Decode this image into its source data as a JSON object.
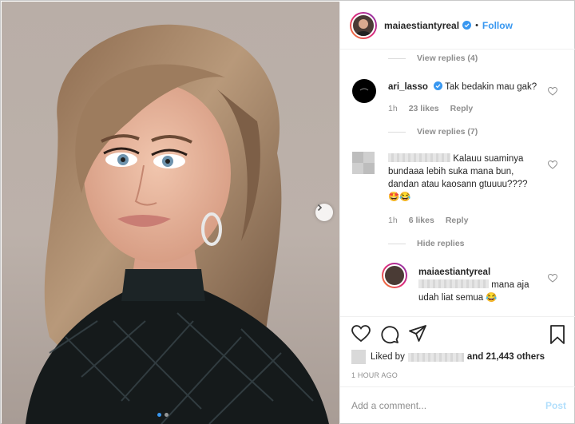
{
  "post": {
    "username": "maiaestiantyreal",
    "follow_label": "Follow",
    "separator": "•"
  },
  "comments": {
    "view_replies_1": "View replies (4)",
    "c1": {
      "user": "ari_lasso",
      "text": "Tak bedakin mau gak?",
      "time": "1h",
      "likes": "23 likes",
      "reply": "Reply"
    },
    "view_replies_2": "View replies (7)",
    "c2": {
      "text_line1": "Kalauu suaminya",
      "text_line2": "bundaaa lebih suka mana bun,",
      "text_line3": "dandan atau kaosann gtuuuu????",
      "emoji": "🤩😂",
      "time": "1h",
      "likes": "6 likes",
      "reply": "Reply"
    },
    "hide_replies": "Hide replies",
    "r1": {
      "user": "maiaestiantyreal",
      "text_line1": "mana aja",
      "text_line2": "udah liat semua",
      "emoji": "😂"
    }
  },
  "footer": {
    "liked_by": "Liked by",
    "and_others": "and 21,443 others",
    "timestamp": "1 HOUR AGO",
    "comment_placeholder": "Add a comment...",
    "post_label": "Post"
  },
  "colors": {
    "link_blue": "#3897f0",
    "muted_gray": "#8e8e8e",
    "text": "#262626",
    "post_disabled": "#b2dffc"
  },
  "icons": [
    "heart-icon",
    "comment-icon",
    "share-icon",
    "bookmark-icon",
    "verified-icon",
    "chevron-right-icon"
  ]
}
